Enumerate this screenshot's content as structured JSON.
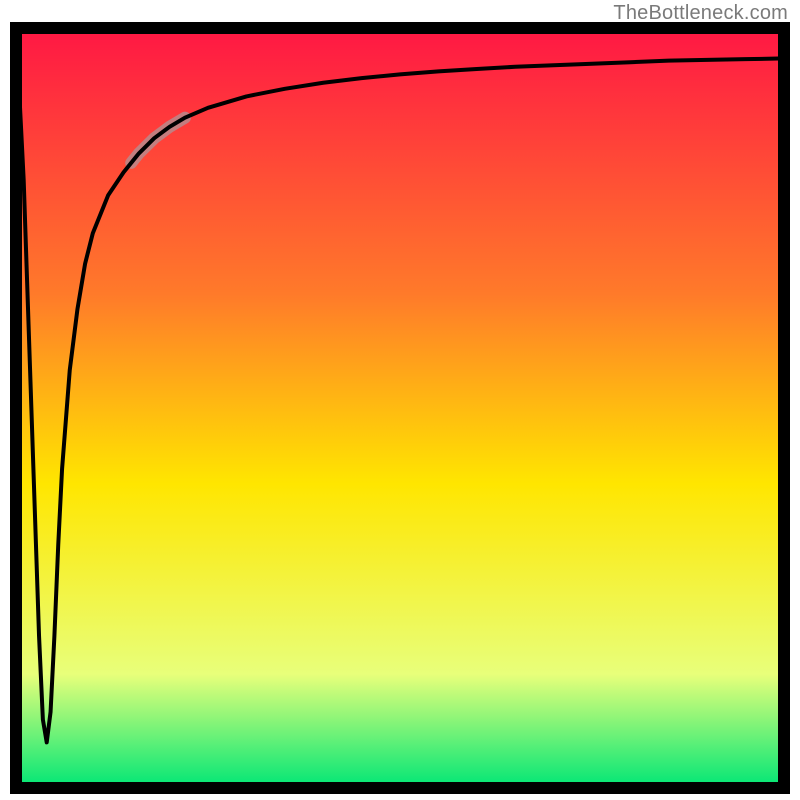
{
  "attribution": "TheBottleneck.com",
  "colors": {
    "border": "#000000",
    "curve": "#000000",
    "highlight": "#b98a8c",
    "gradient_top": "#ff1744",
    "gradient_mid_upper": "#ff7a2a",
    "gradient_mid": "#ffe600",
    "gradient_mid_lower": "#e8ff7a",
    "gradient_bottom": "#00e676"
  },
  "chart_data": {
    "type": "line",
    "title": "",
    "xlabel": "",
    "ylabel": "",
    "xlim": [
      0,
      100
    ],
    "ylim": [
      0,
      100
    ],
    "legend": false,
    "grid": false,
    "series": [
      {
        "name": "bottleneck-curve",
        "x": [
          0.0,
          1.0,
          2.0,
          3.0,
          3.5,
          4.0,
          4.5,
          5.0,
          5.5,
          6.0,
          7.0,
          8.0,
          9.0,
          10.0,
          12.0,
          14.0,
          16.0,
          18.0,
          20.0,
          22.0,
          25.0,
          30.0,
          35.0,
          40.0,
          45.0,
          50.0,
          55.0,
          60.0,
          65.0,
          70.0,
          75.0,
          80.0,
          85.0,
          90.0,
          95.0,
          100.0
        ],
        "y": [
          100.0,
          80.0,
          50.0,
          20.0,
          9.0,
          6.0,
          10.0,
          20.0,
          32.0,
          42.0,
          55.0,
          63.0,
          69.0,
          73.0,
          78.0,
          81.0,
          83.5,
          85.5,
          87.0,
          88.2,
          89.5,
          91.0,
          92.0,
          92.8,
          93.4,
          93.9,
          94.3,
          94.6,
          94.9,
          95.1,
          95.3,
          95.5,
          95.7,
          95.8,
          95.9,
          96.0
        ]
      }
    ],
    "highlight_segment": {
      "series": "bottleneck-curve",
      "x_start": 15.0,
      "x_end": 22.0,
      "stroke_width_px": 12
    },
    "background": {
      "type": "vertical-gradient",
      "stops": [
        {
          "offset": 0.0,
          "color": "#ff1744"
        },
        {
          "offset": 0.35,
          "color": "#ff7a2a"
        },
        {
          "offset": 0.6,
          "color": "#ffe600"
        },
        {
          "offset": 0.85,
          "color": "#e8ff7a"
        },
        {
          "offset": 1.0,
          "color": "#00e676"
        }
      ]
    }
  }
}
